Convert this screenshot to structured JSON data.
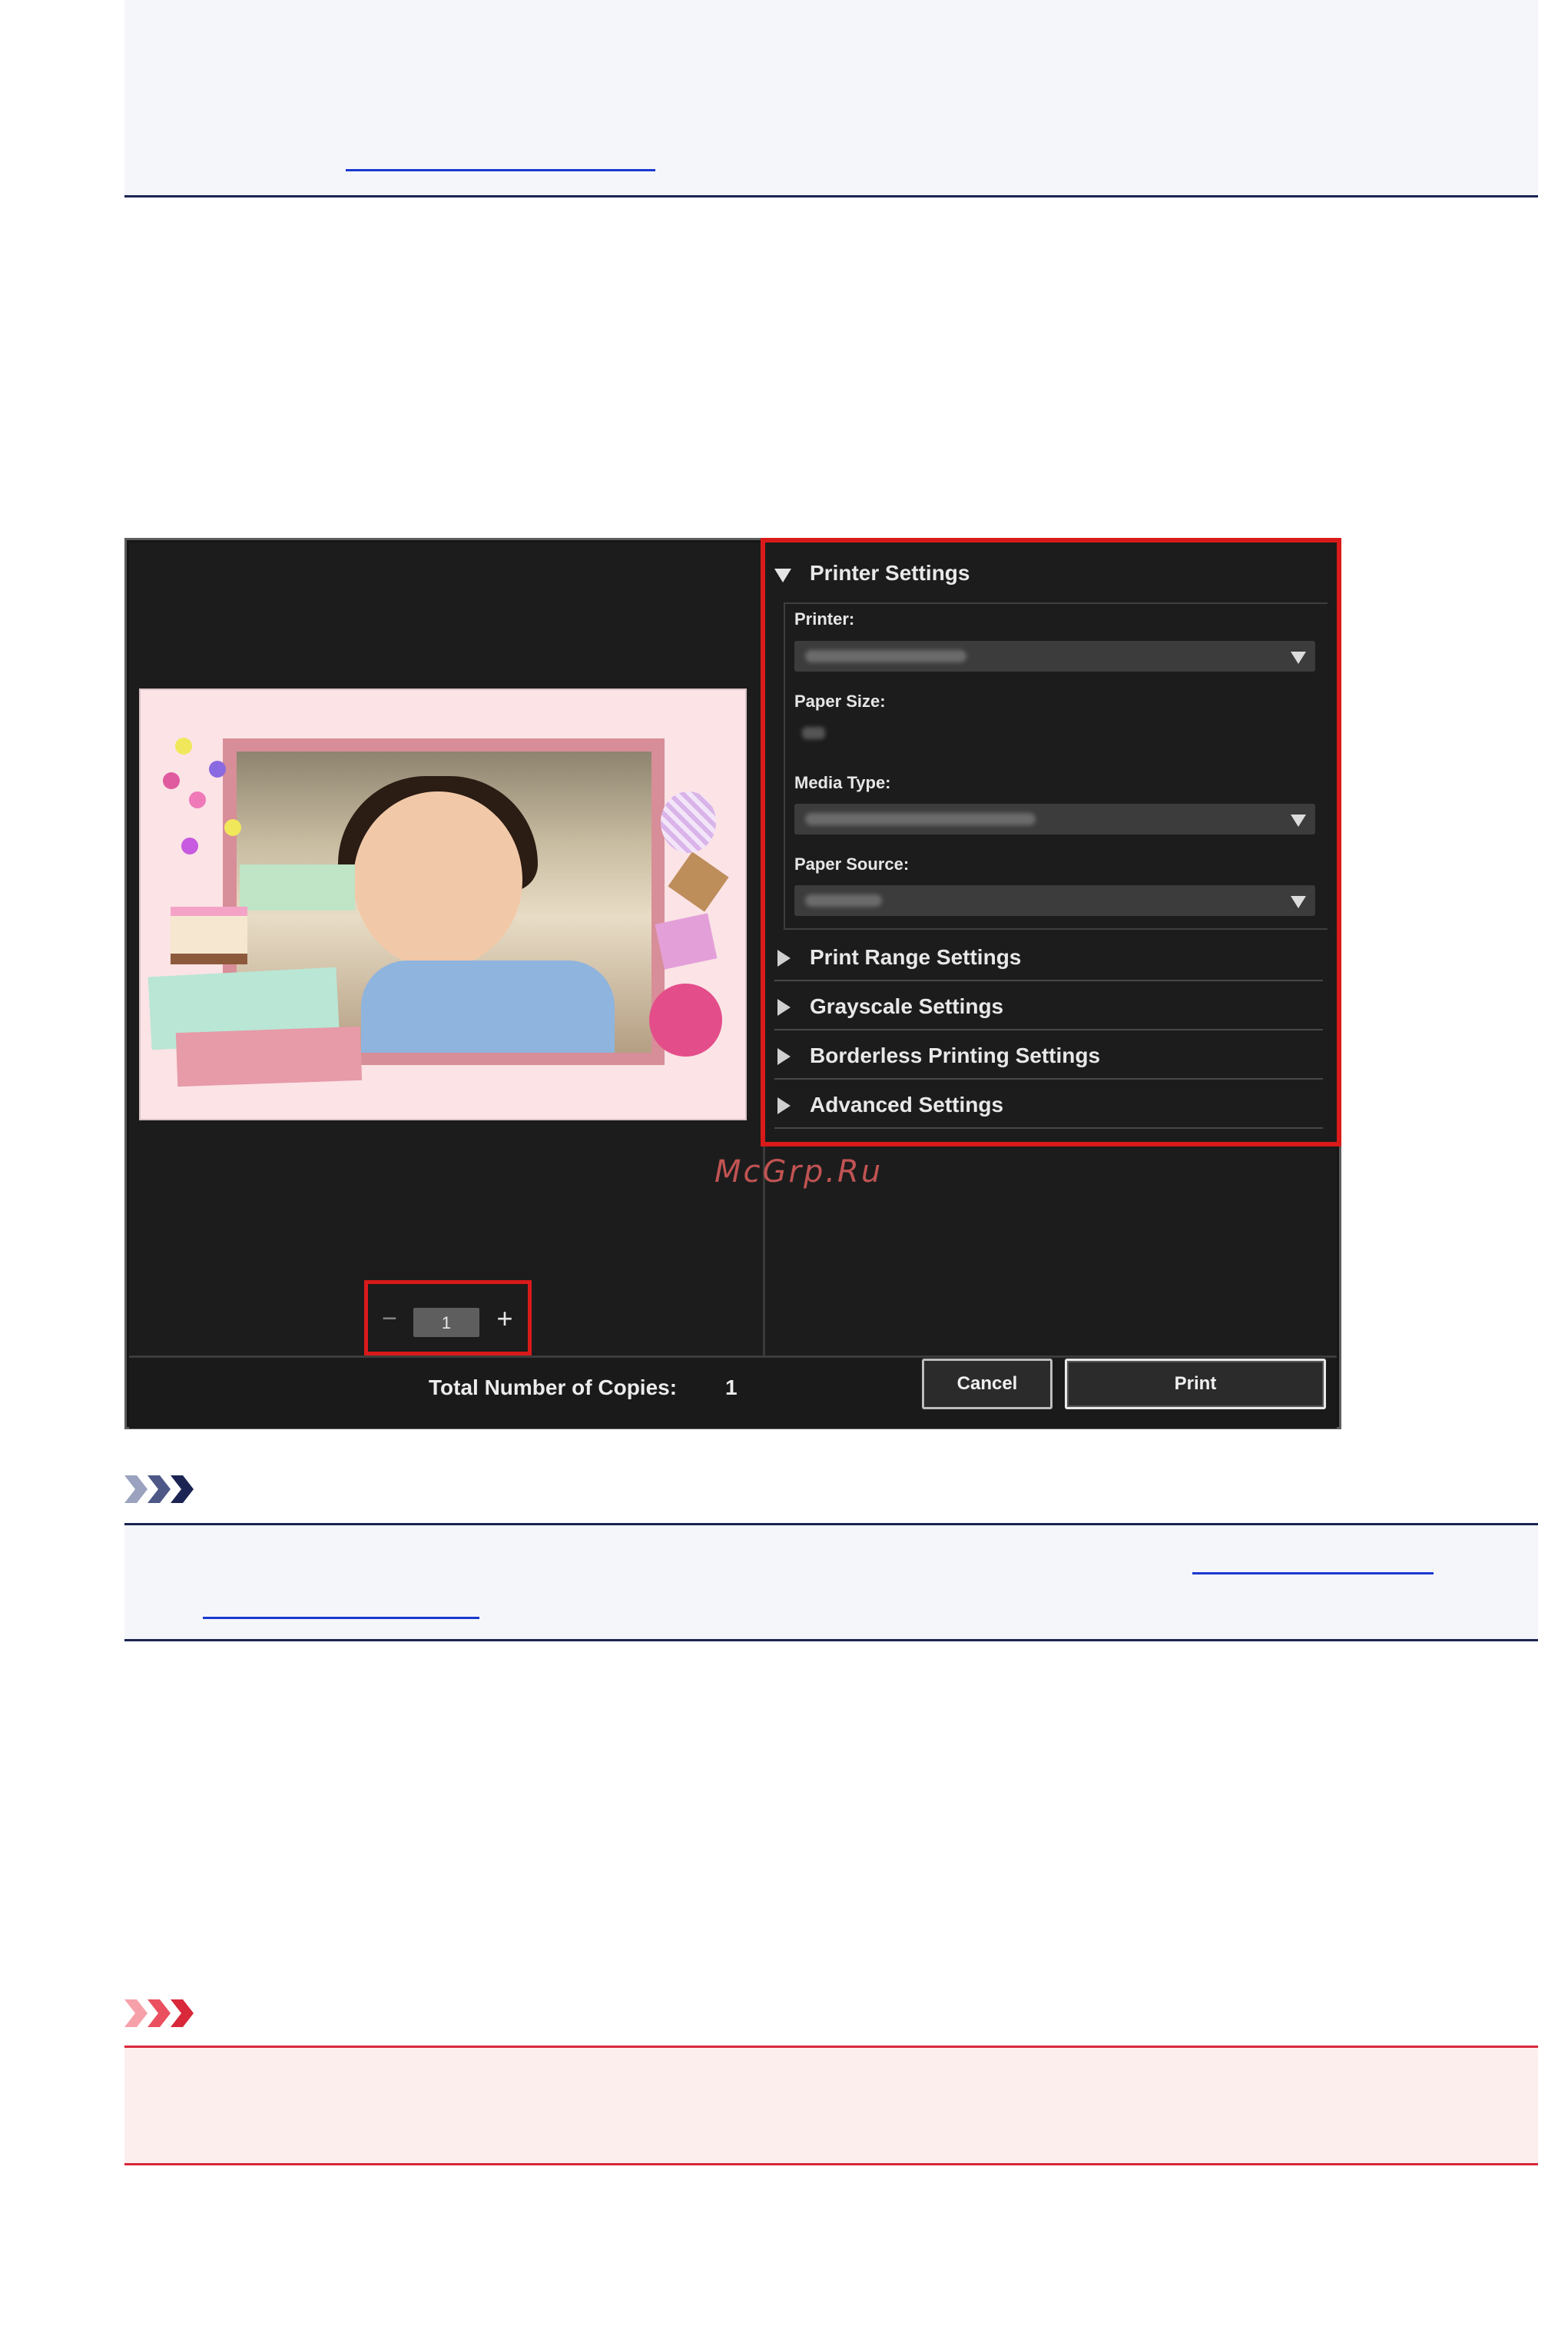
{
  "dialog": {
    "settings": {
      "printer_settings": {
        "title": "Printer Settings",
        "printer_label": "Printer:",
        "paper_size_label": "Paper Size:",
        "media_type_label": "Media Type:",
        "paper_source_label": "Paper Source:"
      },
      "sections": [
        {
          "label": "Print Range Settings"
        },
        {
          "label": "Grayscale Settings"
        },
        {
          "label": "Borderless Printing Settings"
        },
        {
          "label": "Advanced Settings"
        }
      ]
    },
    "copies": {
      "value": "1",
      "minus": "−",
      "plus": "+",
      "total_label": "Total Number of Copies:",
      "total_value": "1"
    },
    "buttons": {
      "cancel": "Cancel",
      "print": "Print"
    }
  },
  "watermark": "McGrp.Ru",
  "colors": {
    "highlight": "#d91a1a",
    "note_rule": "#1b2452",
    "important_rule": "#d8283a",
    "link": "#1b3ad0"
  },
  "icons": {
    "note": "note-chevrons-icon",
    "important": "important-chevrons-icon"
  }
}
